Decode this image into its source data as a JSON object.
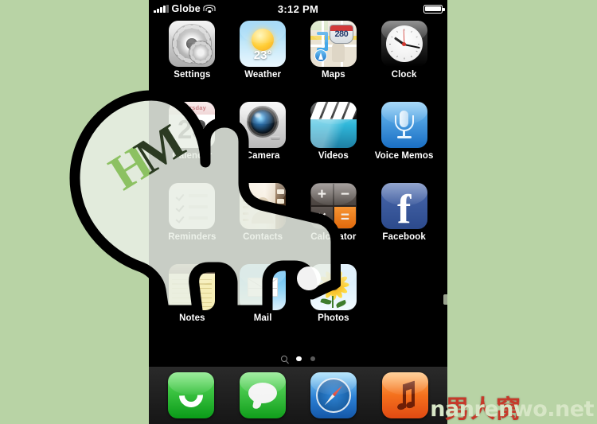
{
  "background_color": "#b8d3a5",
  "device": {
    "screen_bg": "#000000",
    "status_bar": {
      "carrier": "Globe",
      "signal_icon": "signal-bars-icon",
      "wifi_icon": "wifi-icon",
      "time": "3:12 PM",
      "battery_icon": "battery-full-icon"
    },
    "home_screen": {
      "rows": [
        [
          {
            "label": "Settings",
            "icon": "settings-gear-icon"
          },
          {
            "label": "Weather",
            "icon": "weather-sun-icon",
            "value": "23°"
          },
          {
            "label": "Maps",
            "icon": "maps-icon",
            "value": "280"
          },
          {
            "label": "Clock",
            "icon": "clock-icon"
          }
        ],
        [
          {
            "label": "Calendar",
            "icon": "calendar-icon",
            "weekday": "Thursday",
            "day": "23"
          },
          {
            "label": "Camera",
            "icon": "camera-icon"
          },
          {
            "label": "Videos",
            "icon": "videos-clapperboard-icon"
          },
          {
            "label": "Voice Memos",
            "icon": "microphone-icon"
          }
        ],
        [
          {
            "label": "Reminders",
            "icon": "reminders-checklist-icon"
          },
          {
            "label": "Contacts",
            "icon": "contacts-book-icon"
          },
          {
            "label": "Calculator",
            "icon": "calculator-icon",
            "keys": [
              "+",
              "−",
              "×",
              "="
            ]
          },
          {
            "label": "Facebook",
            "icon": "facebook-icon",
            "glyph": "f"
          }
        ],
        [
          {
            "label": "Notes",
            "icon": "notes-pad-icon"
          },
          {
            "label": "Mail",
            "icon": "mail-envelope-icon"
          },
          {
            "label": "Photos",
            "icon": "photos-sunflower-icon"
          }
        ]
      ],
      "page_indicator": {
        "search_icon": "spotlight-search-icon",
        "pages": 2,
        "active_page": 1
      },
      "dock": [
        {
          "label": "Phone",
          "icon": "phone-handset-icon"
        },
        {
          "label": "Messages",
          "icon": "messages-bubble-icon"
        },
        {
          "label": "Safari",
          "icon": "safari-compass-icon"
        },
        {
          "label": "Music",
          "icon": "music-note-icon"
        }
      ]
    }
  },
  "overlay": {
    "cursor": {
      "icon": "pointing-hand-cursor",
      "fill": "#e8eee4",
      "outline": "#000000"
    }
  },
  "watermarks": {
    "hm": {
      "first": "H",
      "second": "M",
      "color_first": "#8cc162",
      "color_second": "#2b3a22"
    },
    "chinese": {
      "text": "男人窝",
      "color": "#c6392a"
    },
    "site": {
      "text": "nanrenwo.net",
      "color": "#d7e6c6"
    }
  }
}
